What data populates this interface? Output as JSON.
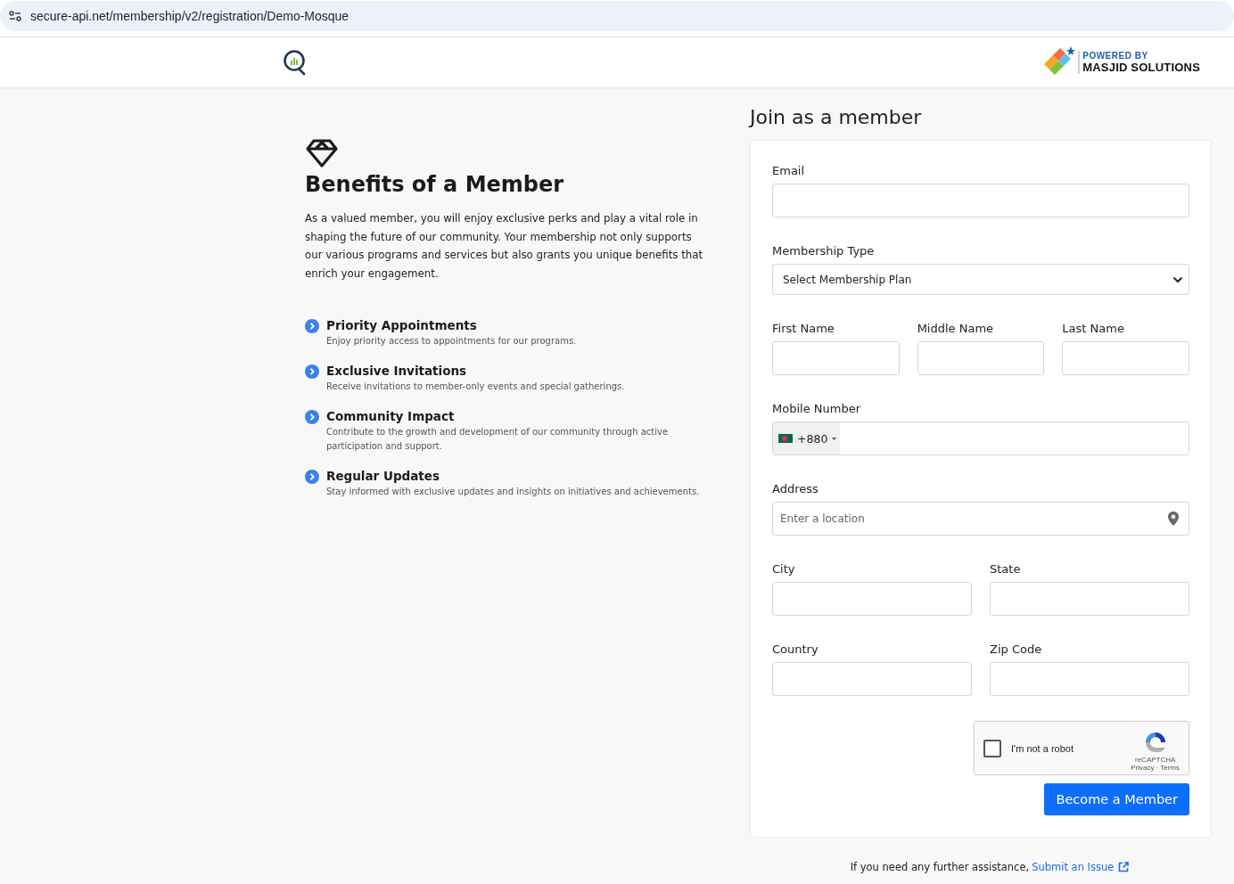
{
  "address_bar": {
    "url": "secure-api.net/membership/v2/registration/Demo-Mosque"
  },
  "header": {
    "powered_by": "POWERED BY",
    "brand": "MASJID SOLUTIONS"
  },
  "benefits": {
    "title": "Benefits of a Member",
    "intro": "As a valued member, you will enjoy exclusive perks and play a vital role in shaping the future of our community. Your membership not only supports our various programs and services but also grants you unique benefits that enrich your engagement.",
    "items": [
      {
        "title": "Priority Appointments",
        "description": "Enjoy priority access to appointments for our programs."
      },
      {
        "title": "Exclusive Invitations",
        "description": "Receive invitations to member-only events and special gatherings."
      },
      {
        "title": "Community Impact",
        "description": "Contribute to the growth and development of our community through active participation and support."
      },
      {
        "title": "Regular Updates",
        "description": "Stay informed with exclusive updates and insights on initiatives and achievements."
      }
    ]
  },
  "form": {
    "title": "Join as a member",
    "rows": [
      [
        {
          "label": "Email",
          "kind": "text"
        }
      ],
      [
        {
          "label": "Membership Type",
          "kind": "select",
          "value": "Select Membership Plan"
        }
      ],
      [
        {
          "label": "First Name",
          "kind": "text"
        },
        {
          "label": "Middle Name",
          "kind": "text"
        },
        {
          "label": "Last Name",
          "kind": "text"
        }
      ],
      [
        {
          "label": "Mobile Number",
          "kind": "phone",
          "code": "+880"
        }
      ],
      [
        {
          "label": "Address",
          "kind": "location",
          "placeholder": "Enter a location"
        }
      ],
      [
        {
          "label": "City",
          "kind": "text"
        },
        {
          "label": "State",
          "kind": "text"
        }
      ],
      [
        {
          "label": "Country",
          "kind": "text"
        },
        {
          "label": "Zip Code",
          "kind": "text"
        }
      ]
    ],
    "captcha": {
      "label": "I'm not a robot",
      "checked": false,
      "brand": "reCAPTCHA",
      "privacy": "Privacy",
      "separator": "·",
      "terms": "Terms"
    },
    "submit": "Become a Member"
  },
  "footer": {
    "text": "If you need any further assistance,",
    "link": "Submit an Issue"
  }
}
